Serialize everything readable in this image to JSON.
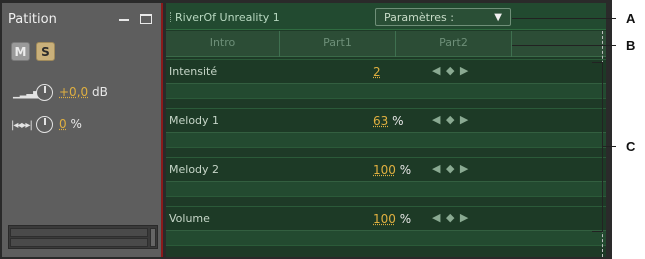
{
  "track": {
    "name": "Patition",
    "mute_label": "M",
    "solo_label": "S",
    "volume_value": "+0,0",
    "volume_unit": "dB",
    "pan_value": "0",
    "pan_unit": "%"
  },
  "clip": {
    "name": "RiverOf Unreality 1",
    "params_label": "Paramètres :"
  },
  "sections": [
    {
      "label": "Intro"
    },
    {
      "label": "Part1"
    },
    {
      "label": "Part2"
    }
  ],
  "lanes": [
    {
      "label": "Intensité",
      "value": "2",
      "unit": ""
    },
    {
      "label": "Melody 1",
      "value": "63",
      "unit": "%"
    },
    {
      "label": "Melody 2",
      "value": "100",
      "unit": "%"
    },
    {
      "label": "Volume",
      "value": "100",
      "unit": "%"
    }
  ],
  "nav_glyph": "◀ ◆ ▶",
  "callouts": {
    "a": "A",
    "b": "B",
    "c": "C"
  },
  "colors": {
    "track_bg": "#5e5e5e",
    "lane_bg": "#1e3a27",
    "accent_value": "#e0b040",
    "solo": "#c9b07a"
  },
  "icons": [
    "minimize-icon",
    "window-icon",
    "volume-bars-icon",
    "pan-icon",
    "dropdown-arrow-icon",
    "prev-keyframe-icon",
    "keyframe-icon",
    "next-keyframe-icon"
  ]
}
